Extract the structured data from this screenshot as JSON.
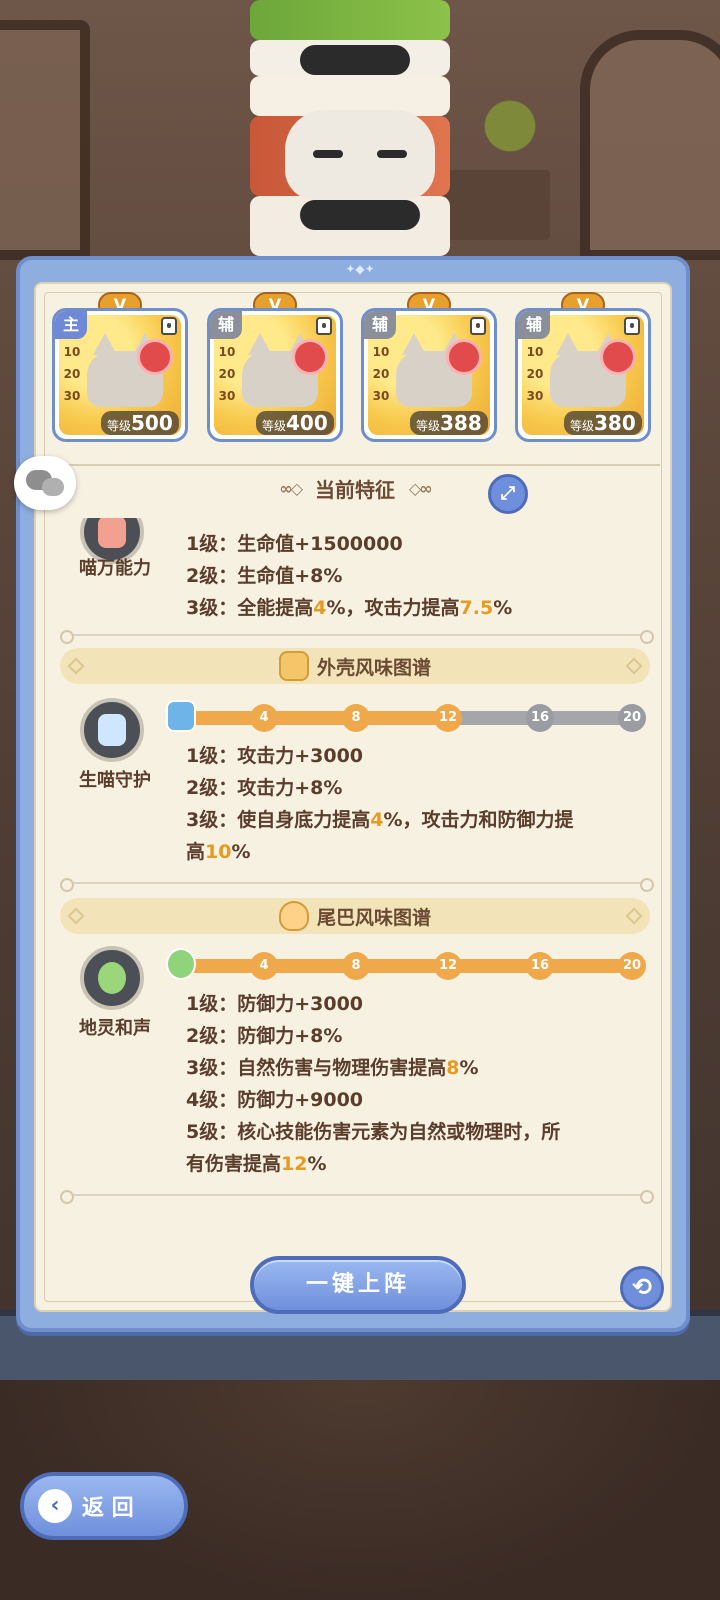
{
  "cards": [
    {
      "role": "主",
      "badge": "V",
      "level_label": "等级",
      "level": "500",
      "milestones": [
        "10",
        "20",
        "30"
      ]
    },
    {
      "role": "辅",
      "badge": "V",
      "level_label": "等级",
      "level": "400",
      "milestones": [
        "10",
        "20",
        "30"
      ]
    },
    {
      "role": "辅",
      "badge": "V",
      "level_label": "等级",
      "level": "388",
      "milestones": [
        "10",
        "20",
        "30"
      ]
    },
    {
      "role": "辅",
      "badge": "V",
      "level_label": "等级",
      "level": "380",
      "milestones": [
        "10",
        "20",
        "30"
      ]
    }
  ],
  "feature_header": {
    "title": "当前特征",
    "expand_icon": "expand-icon"
  },
  "traits": [
    {
      "name": "喵万能力",
      "icon": "shield-icon",
      "lines": [
        {
          "prefix": "1级：生命值+1500000",
          "hl": "",
          "rest": ""
        },
        {
          "prefix": "2级：生命值+8%",
          "hl": "",
          "rest": ""
        },
        {
          "prefix": "3级：全能提高",
          "hl": "4",
          "rest": "%，攻击力提高",
          "hl2": "7.5",
          "rest2": "%"
        }
      ]
    },
    {
      "band": "外壳风味图谱",
      "name": "生喵守护",
      "icon": "cat-shield-icon",
      "progress": {
        "filled_through": 12,
        "nodes": [
          "4",
          "8",
          "12",
          "16",
          "20"
        ],
        "on": [
          true,
          true,
          true,
          false,
          false
        ]
      },
      "lines": [
        {
          "prefix": "1级：攻击力+3000"
        },
        {
          "prefix": "2级：攻击力+8%"
        },
        {
          "prefix": "3级：使自身底力提高",
          "hl": "4",
          "rest": "%，攻击力和防御力提"
        },
        {
          "prefix": "高",
          "hl": "10",
          "rest": "%"
        }
      ]
    },
    {
      "band": "尾巴风味图谱",
      "name": "地灵和声",
      "icon": "clover-icon",
      "progress": {
        "filled_through": 20,
        "nodes": [
          "4",
          "8",
          "12",
          "16",
          "20"
        ],
        "on": [
          true,
          true,
          true,
          true,
          true
        ]
      },
      "lines": [
        {
          "prefix": "1级：防御力+3000"
        },
        {
          "prefix": "2级：防御力+8%"
        },
        {
          "prefix": "3级：自然伤害与物理伤害提高",
          "hl": "8",
          "rest": "%"
        },
        {
          "prefix": "4级：防御力+9000"
        },
        {
          "prefix": "5级：核心技能伤害元素为自然或物理时，所"
        },
        {
          "prefix": "有伤害提高",
          "hl": "12",
          "rest": "%"
        }
      ]
    }
  ],
  "buttons": {
    "deploy": "一键上阵",
    "back": "返 回",
    "refresh_icon": "refresh-icon",
    "chat_icon": "chat-icon"
  },
  "colors": {
    "accent_blue": "#6f8fdc",
    "highlight_orange": "#e59a22",
    "panel_bg": "#f7f1e2"
  }
}
